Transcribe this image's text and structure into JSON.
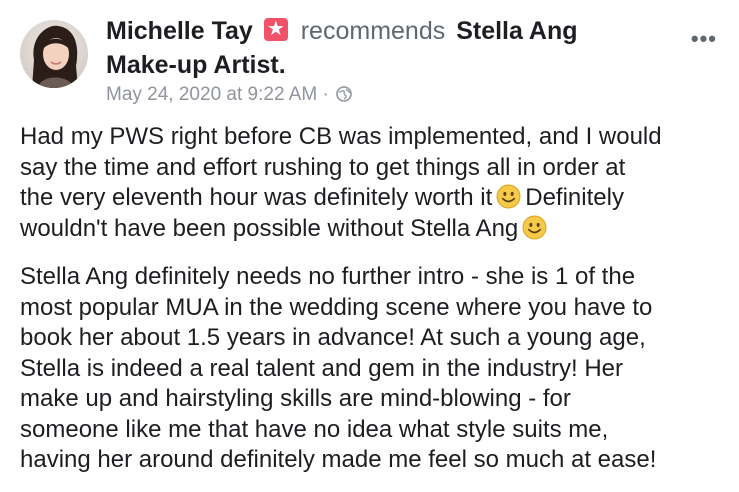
{
  "post": {
    "author": "Michelle Tay",
    "action": "recommends",
    "page_name_line1": "Stella Ang",
    "page_name_line2": "Make-up Artist.",
    "timestamp": "May 24, 2020 at 9:22 AM",
    "separator": "·",
    "privacy_icon": "globe-icon",
    "badge_icon": "star-icon",
    "more_icon": "•••"
  },
  "content": {
    "paragraph1": [
      "Had my PWS right before CB was implemented, and I would",
      "say the time and effort rushing to get things all in order at",
      "the very eleventh hour was definitely worth it",
      "Definitely",
      "wouldn't have been possible without Stella Ang"
    ],
    "paragraph2": [
      "Stella Ang definitely needs no further intro - she is 1 of the",
      "most popular MUA in the wedding scene where you have to",
      "book her about 1.5 years in advance! At such a young age,",
      "Stella is indeed a real talent and gem in the industry! Her",
      "make up and hairstyling skills are mind-blowing - for",
      "someone like me that have no idea what style suits me,",
      "having her around definitely made me feel so much at ease!"
    ]
  },
  "colors": {
    "badge": "#f25268",
    "meta_text": "#90949c",
    "body_text": "#1c1e21"
  }
}
